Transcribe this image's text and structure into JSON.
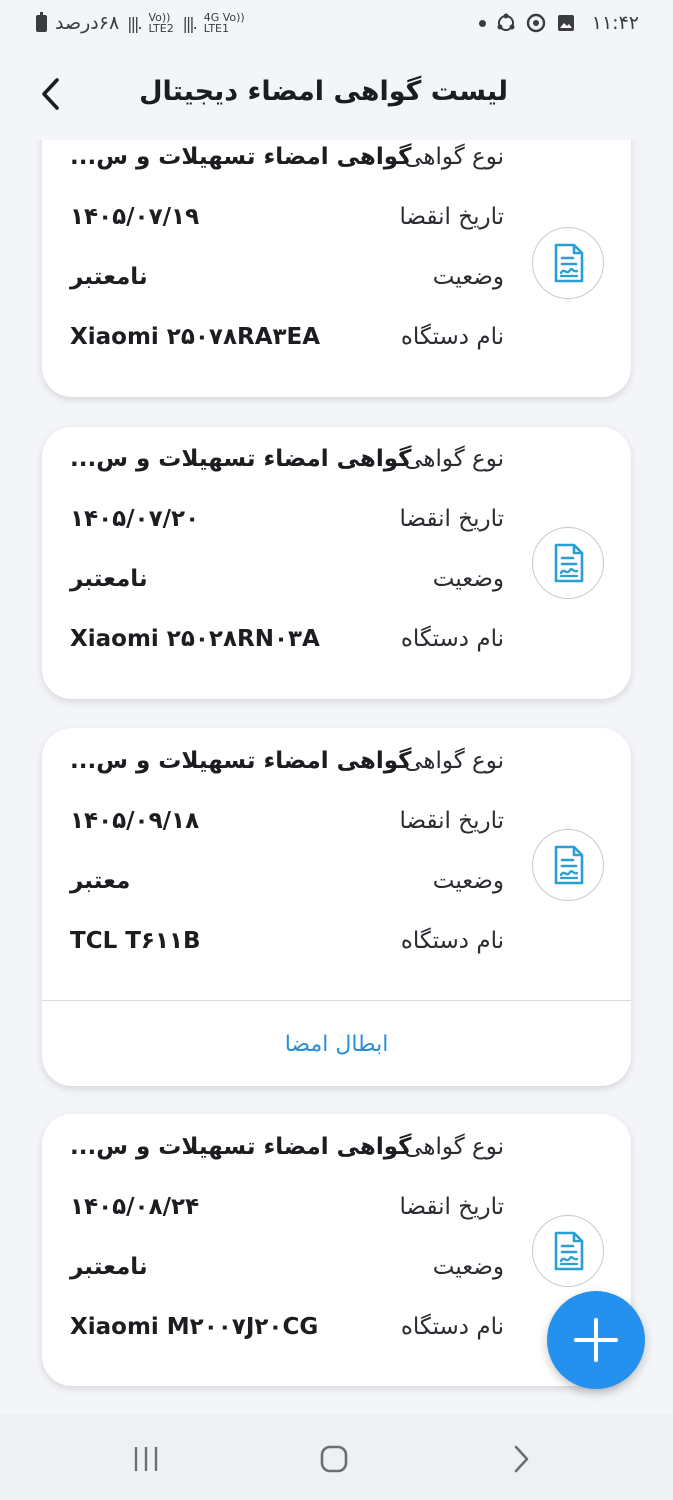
{
  "status_bar": {
    "time": "۱۱:۴۲",
    "battery_text": "۶۸درصد",
    "sim1_label": "Vo)) LTE2",
    "sim2_label": "4G Vo)) LTE1"
  },
  "header": {
    "title": "لیست گواهی امضاء دیجیتال"
  },
  "labels": {
    "type": "نوع گواهی",
    "expiry": "تاریخ انقضا",
    "status": "وضعیت",
    "device": "نام دستگاه"
  },
  "certificates": [
    {
      "type": "گواهی امضاء تسهیلات و س...",
      "expiry": "۱۴۰۵/۰۷/۱۹",
      "status": "نامعتبر",
      "device": "Xiaomi ۲۵۰۷۸RA۳EA"
    },
    {
      "type": "گواهی امضاء تسهیلات و س...",
      "expiry": "۱۴۰۵/۰۷/۲۰",
      "status": "نامعتبر",
      "device": "Xiaomi ۲۵۰۲۸RN۰۳A"
    },
    {
      "type": "گواهی امضاء تسهیلات و س...",
      "expiry": "۱۴۰۵/۰۹/۱۸",
      "status": "معتبر",
      "device": "TCL T۶۱۱B",
      "action": "ابطال امضا"
    },
    {
      "type": "گواهی امضاء تسهیلات و س...",
      "expiry": "۱۴۰۵/۰۸/۲۴",
      "status": "نامعتبر",
      "device": "Xiaomi M۲۰۰۷J۲۰CG"
    }
  ],
  "icons": {
    "back": "chevron-left-icon",
    "certificate": "signed-document-icon",
    "add": "plus-icon"
  },
  "colors": {
    "accent": "#2491ee",
    "link": "#2b8fd6",
    "icon": "#2a9fd6"
  }
}
